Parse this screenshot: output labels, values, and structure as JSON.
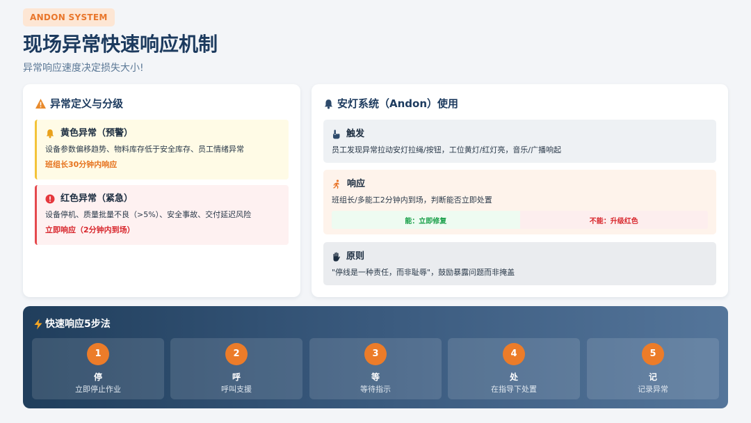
{
  "header": {
    "badge": "ANDON SYSTEM",
    "title": "现场异常快速响应机制",
    "subtitle": "异常响应速度决定损失大小!"
  },
  "left_card": {
    "title": "异常定义与分级",
    "icon": "warning-triangle-icon",
    "levels": [
      {
        "icon": "bell-icon",
        "title": "黄色异常（预警）",
        "desc": "设备参数偏移趋势、物料库存低于安全库存、员工情绪异常",
        "response": "班组长30分钟内响应"
      },
      {
        "icon": "exclamation-circle-icon",
        "title": "红色异常（紧急）",
        "desc": "设备停机、质量批量不良（>5%）、安全事故、交付延迟风险",
        "response": "立即响应（2分钟内到场）"
      }
    ]
  },
  "right_card": {
    "title": "安灯系统（Andon）使用",
    "icon": "bell-icon",
    "trigger": {
      "icon": "pointing-hand-icon",
      "title": "触发",
      "desc": "员工发现异常拉动安灯拉绳/按钮，工位黄灯/红灯亮，音乐/广播响起"
    },
    "respond": {
      "icon": "running-person-icon",
      "title": "响应",
      "desc": "班组长/多能工2分钟内到场，判断能否立即处置",
      "option_ok": "能：立即修复",
      "option_no": "不能：升级红色"
    },
    "principle": {
      "icon": "hand-icon",
      "title": "原则",
      "desc": "\"停线是一种责任，而非耻辱\"，鼓励暴露问题而非掩盖"
    }
  },
  "steps": {
    "title": "快速响应5步法",
    "icon": "lightning-icon",
    "items": [
      {
        "num": "1",
        "name": "停",
        "desc": "立即停止作业"
      },
      {
        "num": "2",
        "name": "呼",
        "desc": "呼叫支援"
      },
      {
        "num": "3",
        "name": "等",
        "desc": "等待指示"
      },
      {
        "num": "4",
        "name": "处",
        "desc": "在指导下处置"
      },
      {
        "num": "5",
        "name": "记",
        "desc": "记录异常"
      }
    ]
  },
  "colors": {
    "accent_orange": "#ec7c29",
    "yellow_border": "#f3c338",
    "red_border": "#e5484d",
    "title_navy": "#1c3a5e"
  }
}
